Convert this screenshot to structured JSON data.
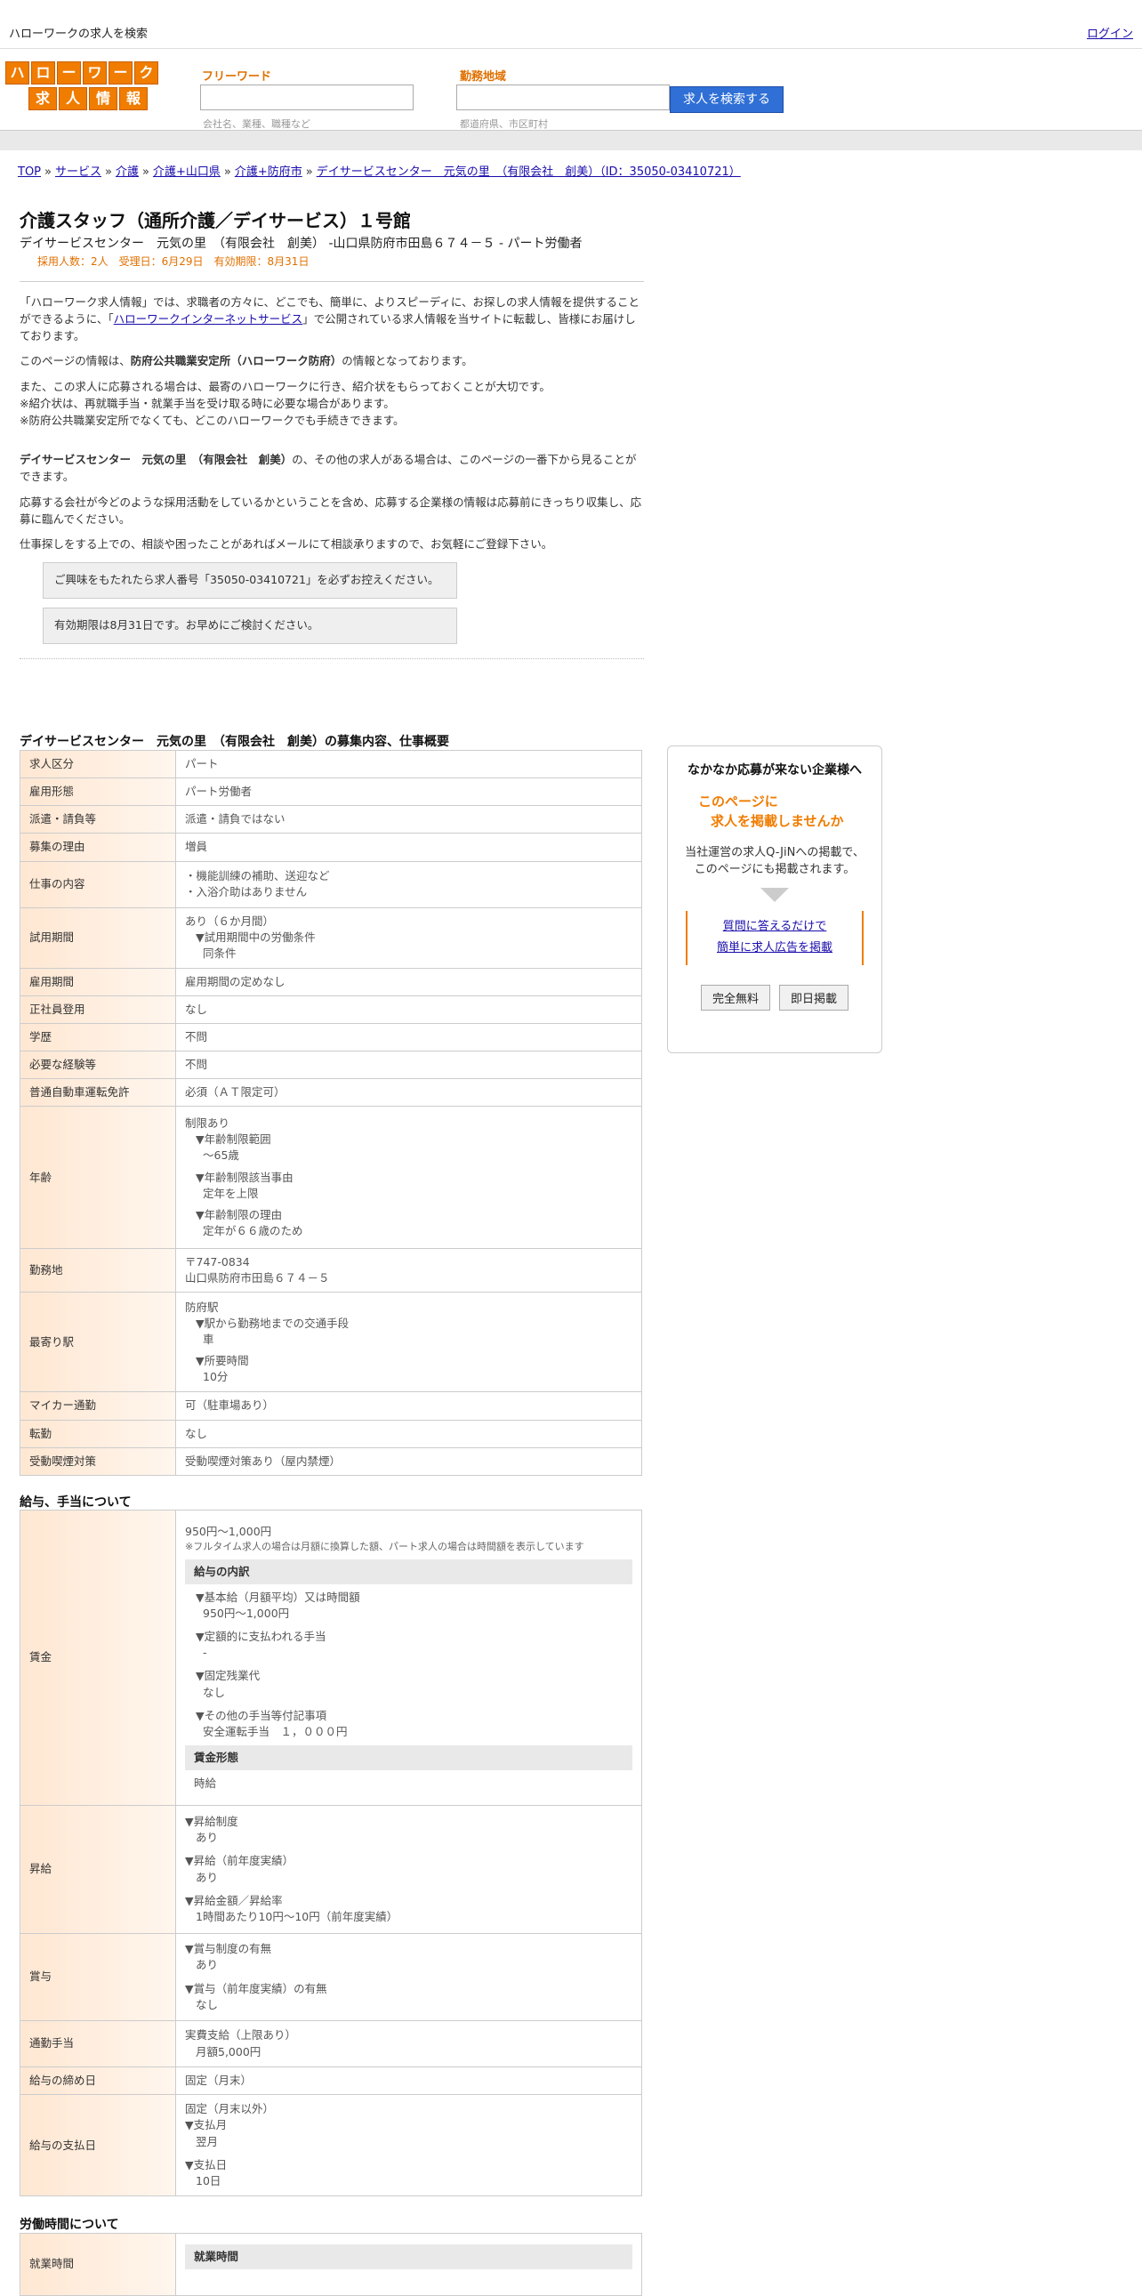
{
  "top": {
    "site_title": "ハローワークの求人を検索",
    "login": "ログイン"
  },
  "logo": {
    "row1": [
      "ハ",
      "ロ",
      "ー",
      "ワ",
      "ー",
      "ク"
    ],
    "row2": [
      "求",
      "人",
      "情",
      "報"
    ]
  },
  "search": {
    "freeword_label": "フリーワード",
    "freeword_hint": "会社名、業種、職種など",
    "area_label": "勤務地域",
    "area_hint": "都道府県、市区町村",
    "button": "求人を検索する"
  },
  "breadcrumb": [
    "TOP",
    "サービス",
    "介護",
    "介護+山口県",
    "介護+防府市",
    "デイサービスセンター　元気の里　（有限会社　創美）（ID：35050-03410721）"
  ],
  "job": {
    "title": "介護スタッフ（通所介護／デイサービス）１号館",
    "subtitle": "デイサービスセンター　元気の里　（有限会社　創美） -山口県防府市田島６７４－５ - パート労働者",
    "meta": "採用人数：2人　受理日：6月29日　有効期限：8月31日"
  },
  "intro": {
    "p1a": "「ハローワーク求人情報」では、求職者の方々に、どこでも、簡単に、よりスピーディに、お探しの求人情報を提供することができるように、「",
    "p1_link": "ハローワークインターネットサービス",
    "p1b": "」で公開されている求人情報を当サイトに転載し、皆様にお届けしております。",
    "p2a": "このページの情報は、",
    "p2_bold": "防府公共職業安定所（ハローワーク防府）",
    "p2b": "の情報となっております。",
    "p3": "また、この求人に応募される場合は、最寄のハローワークに行き、紹介状をもらっておくことが大切です。",
    "p3b": "※紹介状は、再就職手当・就業手当を受け取る時に必要な場合があります。",
    "p3c": "※防府公共職業安定所でなくても、どこのハローワークでも手続きできます。",
    "p4_bold": "デイサービスセンター　元気の里　（有限会社　創美）",
    "p4": "の、その他の求人がある場合は、このページの一番下から見ることができます。",
    "p5": "応募する会社が今どのような採用活動をしているかということを含め、応募する企業様の情報は応募前にきっちり収集し、応募に臨んでください。",
    "p6": "仕事探しをする上での、相談や困ったことがあればメールにて相談承りますので、お気軽にご登録下さい。",
    "box1": "ご興味をもたれたら求人番号「35050-03410721」を必ずお控えください。",
    "box2": "有効期限は8月31日です。お早めにご検討ください。"
  },
  "section1": {
    "title": "デイサービスセンター　元気の里　（有限会社　創美）の募集内容、仕事概要",
    "rows": [
      {
        "k": "求人区分",
        "v": "パート"
      },
      {
        "k": "雇用形態",
        "v": "パート労働者"
      },
      {
        "k": "派遣・請負等",
        "v": "派遣・請負ではない"
      },
      {
        "k": "募集の理由",
        "v": "増員"
      },
      {
        "k": "仕事の内容",
        "v1": "・機能訓練の補助、送迎など",
        "v2": "・入浴介助はありません"
      },
      {
        "k": "試用期間",
        "v1": "あり（６か月間）",
        "v2": "▼試用期間中の労働条件",
        "v3": "同条件"
      },
      {
        "k": "雇用期間",
        "v": "雇用期間の定めなし"
      },
      {
        "k": "正社員登用",
        "v": "なし"
      },
      {
        "k": "学歴",
        "v": "不問"
      },
      {
        "k": "必要な経験等",
        "v": "不問"
      },
      {
        "k": "普通自動車運転免許",
        "v": "必須（ＡＴ限定可）"
      },
      {
        "k": "年齢",
        "v1": "制限あり",
        "v2": "▼年齢制限範囲",
        "v3": "〜65歳",
        "v4": "▼年齢制限該当事由",
        "v5": "定年を上限",
        "v6": "▼年齢制限の理由",
        "v7": "定年が６６歳のため"
      },
      {
        "k": "勤務地",
        "v1": "〒747-0834",
        "v2": "山口県防府市田島６７４－５"
      },
      {
        "k": "最寄り駅",
        "v1": "防府駅",
        "v2": "▼駅から勤務地までの交通手段",
        "v3": "車",
        "v4": "▼所要時間",
        "v5": "10分"
      },
      {
        "k": "マイカー通勤",
        "v": "可（駐車場あり）"
      },
      {
        "k": "転勤",
        "v": "なし"
      },
      {
        "k": "受動喫煙対策",
        "v": "受動喫煙対策あり（屋内禁煙）"
      }
    ]
  },
  "section2": {
    "title": "給与、手当について",
    "wage_k": "賃金",
    "wage_v": "950円〜1,000円",
    "wage_note": "※フルタイム求人の場合は月額に換算した額、パート求人の場合は時間額を表示しています",
    "breakdown": "給与の内訳",
    "b1": "▼基本給（月額平均）又は時間額",
    "b1v": "950円〜1,000円",
    "b2": "▼定額的に支払われる手当",
    "b2v": "-",
    "b3": "▼固定残業代",
    "b3v": "なし",
    "b4": "▼その他の手当等付記事項",
    "b4v": "安全運転手当　１，０００円",
    "form_head": "賃金形態",
    "form_v": "時給",
    "raise_k": "昇給",
    "r1": "▼昇給制度",
    "r1v": "あり",
    "r2": "▼昇給（前年度実績）",
    "r2v": "あり",
    "r3": "▼昇給金額／昇給率",
    "r3v": "1時間あたり10円〜10円（前年度実績）",
    "bonus_k": "賞与",
    "bo1": "▼賞与制度の有無",
    "bo1v": "あり",
    "bo2": "▼賞与（前年度実績）の有無",
    "bo2v": "なし",
    "commute_k": "通勤手当",
    "commute_v1": "実費支給（上限あり）",
    "commute_v2": "月額5,000円",
    "close_k": "給与の締め日",
    "close_v": "固定（月末）",
    "pay_k": "給与の支払日",
    "pay_v1": "固定（月末以外）",
    "pay_v2": "▼支払月",
    "pay_v3": "翌月",
    "pay_v4": "▼支払日",
    "pay_v5": "10日"
  },
  "section3": {
    "title": "労働時間について",
    "hours_k": "就業時間",
    "hours_head": "就業時間"
  },
  "side": {
    "t1": "なかなか応募が来ない企業様へ",
    "t2a": "このページに",
    "t2b": "求人を掲載しませんか",
    "t3a": "当社運営の求人Q-JiNへの掲載で、",
    "t3b": "このページにも掲載されます。",
    "link1": "質問に答えるだけで",
    "link2": "簡単に求人広告を掲載",
    "btn1": "完全無料",
    "btn2": "即日掲載"
  }
}
